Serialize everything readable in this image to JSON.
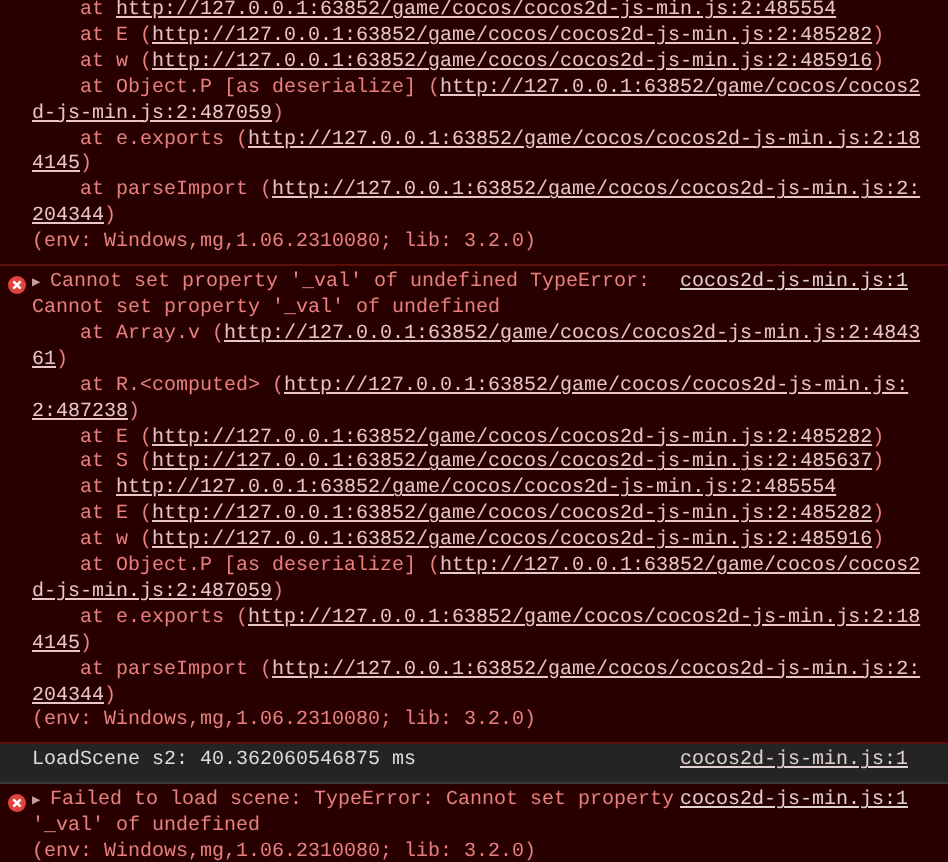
{
  "messages": [
    {
      "kind": "error-continued",
      "lines": [
        {
          "kind": "frame",
          "segments": [
            {
              "text": "at ",
              "link": false
            },
            {
              "text": "http://127.0.0.1:63852/game/cocos/cocos2d-js-min.js:2:485554",
              "link": true
            }
          ]
        },
        {
          "kind": "frame",
          "segments": [
            {
              "text": "at E (",
              "link": false
            },
            {
              "text": "http://127.0.0.1:63852/game/cocos/cocos2d-js-min.js:2:485282",
              "link": true
            },
            {
              "text": ")",
              "link": false
            }
          ]
        },
        {
          "kind": "frame",
          "segments": [
            {
              "text": "at w (",
              "link": false
            },
            {
              "text": "http://127.0.0.1:63852/game/cocos/cocos2d-js-min.js:2:485916",
              "link": true
            },
            {
              "text": ")",
              "link": false
            }
          ]
        },
        {
          "kind": "frame",
          "segments": [
            {
              "text": "at Object.P [as deserialize] (",
              "link": false
            },
            {
              "text": "http://127.0.0.1:63852/game/cocos/cocos2",
              "link": true
            }
          ]
        },
        {
          "kind": "wrap",
          "segments": [
            {
              "text": "d-js-min.js:2:487059",
              "link": true
            },
            {
              "text": ")",
              "link": false
            }
          ]
        },
        {
          "kind": "frame",
          "segments": [
            {
              "text": "at e.exports (",
              "link": false
            },
            {
              "text": "http://127.0.0.1:63852/game/cocos/cocos2d-js-min.js:2:18",
              "link": true
            }
          ]
        },
        {
          "kind": "wrap",
          "segments": [
            {
              "text": "4145",
              "link": true
            },
            {
              "text": ")",
              "link": false
            }
          ]
        },
        {
          "kind": "frame",
          "segments": [
            {
              "text": "at parseImport (",
              "link": false
            },
            {
              "text": "http://127.0.0.1:63852/game/cocos/cocos2d-js-min.js:2:",
              "link": true
            }
          ]
        },
        {
          "kind": "wrap",
          "segments": [
            {
              "text": "204344",
              "link": true
            },
            {
              "text": ")",
              "link": false
            }
          ]
        },
        {
          "kind": "wrap",
          "segments": [
            {
              "text": "(env: Windows,mg,1.06.2310080; lib: 3.2.0)",
              "link": false
            }
          ]
        }
      ]
    },
    {
      "kind": "error",
      "toggle": "▶",
      "head": "Cannot set property '_val' of undefined TypeError:",
      "source": "cocos2d-js-min.js:1",
      "lines": [
        {
          "kind": "wrap",
          "segments": [
            {
              "text": "Cannot set property '_val' of undefined",
              "link": false
            }
          ]
        },
        {
          "kind": "frame",
          "segments": [
            {
              "text": "at Array.v (",
              "link": false
            },
            {
              "text": "http://127.0.0.1:63852/game/cocos/cocos2d-js-min.js:2:4843",
              "link": true
            }
          ]
        },
        {
          "kind": "wrap",
          "segments": [
            {
              "text": "61",
              "link": true
            },
            {
              "text": ")",
              "link": false
            }
          ]
        },
        {
          "kind": "frame",
          "segments": [
            {
              "text": "at R.<computed> (",
              "link": false
            },
            {
              "text": "http://127.0.0.1:63852/game/cocos/cocos2d-js-min.js:",
              "link": true
            }
          ]
        },
        {
          "kind": "wrap",
          "segments": [
            {
              "text": "2:487238",
              "link": true
            },
            {
              "text": ")",
              "link": false
            }
          ]
        },
        {
          "kind": "frame",
          "segments": [
            {
              "text": "at E (",
              "link": false
            },
            {
              "text": "http://127.0.0.1:63852/game/cocos/cocos2d-js-min.js:2:485282",
              "link": true
            },
            {
              "text": ")",
              "link": false
            }
          ]
        },
        {
          "kind": "frame",
          "segments": [
            {
              "text": "at S (",
              "link": false
            },
            {
              "text": "http://127.0.0.1:63852/game/cocos/cocos2d-js-min.js:2:485637",
              "link": true
            },
            {
              "text": ")",
              "link": false
            }
          ]
        },
        {
          "kind": "frame",
          "segments": [
            {
              "text": "at ",
              "link": false
            },
            {
              "text": "http://127.0.0.1:63852/game/cocos/cocos2d-js-min.js:2:485554",
              "link": true
            }
          ]
        },
        {
          "kind": "frame",
          "segments": [
            {
              "text": "at E (",
              "link": false
            },
            {
              "text": "http://127.0.0.1:63852/game/cocos/cocos2d-js-min.js:2:485282",
              "link": true
            },
            {
              "text": ")",
              "link": false
            }
          ]
        },
        {
          "kind": "frame",
          "segments": [
            {
              "text": "at w (",
              "link": false
            },
            {
              "text": "http://127.0.0.1:63852/game/cocos/cocos2d-js-min.js:2:485916",
              "link": true
            },
            {
              "text": ")",
              "link": false
            }
          ]
        },
        {
          "kind": "frame",
          "segments": [
            {
              "text": "at Object.P [as deserialize] (",
              "link": false
            },
            {
              "text": "http://127.0.0.1:63852/game/cocos/cocos2",
              "link": true
            }
          ]
        },
        {
          "kind": "wrap",
          "segments": [
            {
              "text": "d-js-min.js:2:487059",
              "link": true
            },
            {
              "text": ")",
              "link": false
            }
          ]
        },
        {
          "kind": "frame",
          "segments": [
            {
              "text": "at e.exports (",
              "link": false
            },
            {
              "text": "http://127.0.0.1:63852/game/cocos/cocos2d-js-min.js:2:18",
              "link": true
            }
          ]
        },
        {
          "kind": "wrap",
          "segments": [
            {
              "text": "4145",
              "link": true
            },
            {
              "text": ")",
              "link": false
            }
          ]
        },
        {
          "kind": "frame",
          "segments": [
            {
              "text": "at parseImport (",
              "link": false
            },
            {
              "text": "http://127.0.0.1:63852/game/cocos/cocos2d-js-min.js:2:",
              "link": true
            }
          ]
        },
        {
          "kind": "wrap",
          "segments": [
            {
              "text": "204344",
              "link": true
            },
            {
              "text": ")",
              "link": false
            }
          ]
        },
        {
          "kind": "wrap",
          "segments": [
            {
              "text": "(env: Windows,mg,1.06.2310080; lib: 3.2.0)",
              "link": false
            }
          ]
        }
      ]
    },
    {
      "kind": "log",
      "head": "LoadScene s2: 40.362060546875 ms",
      "source": "cocos2d-js-min.js:1"
    },
    {
      "kind": "error",
      "toggle": "▶",
      "head": "Failed to load scene: TypeError: Cannot set property",
      "source": "cocos2d-js-min.js:1",
      "lines": [
        {
          "kind": "wrap",
          "segments": [
            {
              "text": "'_val' of undefined",
              "link": false
            }
          ]
        },
        {
          "kind": "wrap",
          "segments": [
            {
              "text": "(env: Windows,mg,1.06.2310080; lib: 3.2.0)",
              "link": false
            }
          ]
        }
      ]
    }
  ]
}
